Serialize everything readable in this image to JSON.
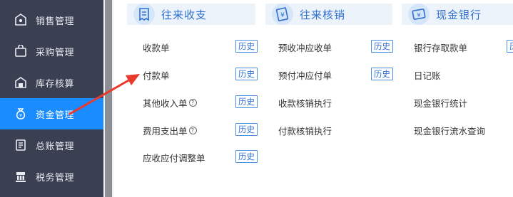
{
  "sidebar": {
    "items": [
      {
        "label": "销售管理",
        "icon": "sales-icon"
      },
      {
        "label": "采购管理",
        "icon": "bag-icon"
      },
      {
        "label": "库存核算",
        "icon": "warehouse-icon"
      },
      {
        "label": "资金管理",
        "icon": "money-bag-icon",
        "active": true
      },
      {
        "label": "总账管理",
        "icon": "ledger-icon"
      },
      {
        "label": "税务管理",
        "icon": "tax-icon"
      }
    ]
  },
  "sections": [
    {
      "title": "往来收支",
      "icon": "receipt-icon",
      "items": [
        {
          "label": "收款单",
          "history": "历史"
        },
        {
          "label": "付款单",
          "history": "历史"
        },
        {
          "label": "其他收入单",
          "help": "?",
          "history": "历史"
        },
        {
          "label": "费用支出单",
          "help": "?",
          "history": "历史"
        },
        {
          "label": "应收应付调整单",
          "history": "历史"
        }
      ]
    },
    {
      "title": "往来核销",
      "icon": "yen-document-icon",
      "items": [
        {
          "label": "预收冲应收单",
          "history": "历史"
        },
        {
          "label": "预付冲应付单",
          "history": "历史"
        },
        {
          "label": "收款核销执行"
        },
        {
          "label": "付款核销执行"
        }
      ]
    },
    {
      "title": "现金银行",
      "icon": "bank-card-icon",
      "items": [
        {
          "label": "银行存取款单",
          "history": "历"
        },
        {
          "label": "日记账"
        },
        {
          "label": "现金银行统计"
        },
        {
          "label": "现金银行流水查询"
        }
      ]
    }
  ],
  "colors": {
    "sidebar_bg": "#3a3f51",
    "active_bg": "#1a8cff",
    "accent": "#2f6fd1",
    "annotation_arrow": "#e8392c"
  }
}
